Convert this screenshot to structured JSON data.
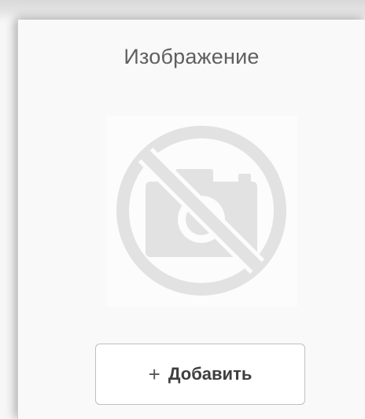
{
  "image_widget": {
    "title": "Изображение",
    "placeholder_icon": "no-camera-icon",
    "add_button": {
      "icon": "+",
      "label": "Добавить"
    }
  },
  "colors": {
    "panel_background": "#f9f9f9",
    "icon_gray": "#e2e2e2",
    "title_text": "#5f5f5f",
    "button_border": "#bfbfbf"
  }
}
